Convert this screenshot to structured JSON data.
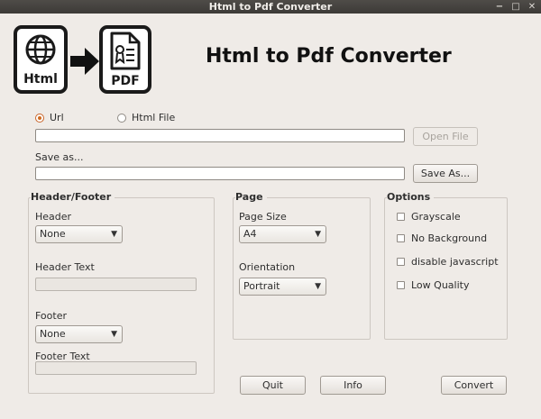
{
  "window": {
    "title": "Html to Pdf Converter",
    "controls": [
      "−",
      "□",
      "✕"
    ]
  },
  "header": {
    "title": "Html to Pdf Converter",
    "logo_html_text": "Html",
    "logo_pdf_text": "PDF"
  },
  "source": {
    "options": [
      {
        "label": "Url",
        "checked": true
      },
      {
        "label": "Html File",
        "checked": false
      }
    ],
    "url_value": "",
    "open_file_label": "Open File"
  },
  "save": {
    "label": "Save as...",
    "value": "",
    "button_label": "Save As..."
  },
  "header_footer": {
    "title": "Header/Footer",
    "header_label": "Header",
    "header_value": "None",
    "header_text_label": "Header Text",
    "footer_label": "Footer",
    "footer_value": "None",
    "footer_text_label": "Footer Text"
  },
  "page": {
    "title": "Page",
    "size_label": "Page Size",
    "size_value": "A4",
    "orientation_label": "Orientation",
    "orientation_value": "Portrait"
  },
  "options": {
    "title": "Options",
    "items": [
      {
        "label": "Grayscale",
        "checked": false
      },
      {
        "label": "No Background",
        "checked": false
      },
      {
        "label": "disable javascript",
        "checked": false
      },
      {
        "label": "Low Quality",
        "checked": false
      }
    ]
  },
  "actions": {
    "quit": "Quit",
    "info": "Info",
    "convert": "Convert"
  },
  "icons": {
    "globe": "globe-icon",
    "arrow": "arrow-right-icon",
    "document": "pdf-document-icon",
    "chevron": "chevron-down-icon"
  }
}
